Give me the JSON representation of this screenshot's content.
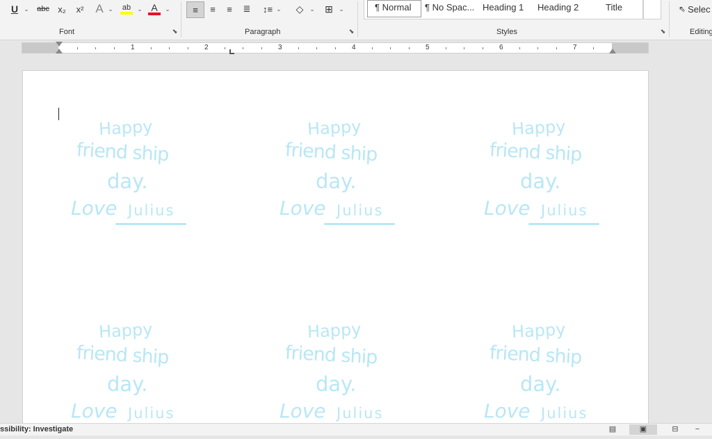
{
  "ribbon": {
    "groups": {
      "font": "Font",
      "paragraph": "Paragraph",
      "styles": "Styles",
      "editing": "Editing"
    },
    "font_tools": {
      "underline": "U",
      "strikethrough": "abc",
      "subscript": "x₂",
      "superscript": "x²",
      "text_effects": "A",
      "highlight": "ab",
      "font_color": "A"
    },
    "styles": [
      "¶ Normal",
      "¶ No Spac...",
      "Heading 1",
      "Heading 2",
      "Title"
    ],
    "editing": {
      "select": "Selec"
    },
    "colors": {
      "highlight": "#ffff00",
      "font_color": "#e81123"
    }
  },
  "ruler": {
    "numbers": [
      "1",
      "2",
      "3",
      "4",
      "5",
      "6",
      "7"
    ]
  },
  "labels": [
    {
      "line1": "Happy",
      "line2": "friend ship",
      "line3": "day.",
      "line4": "Love",
      "line5": "Julius"
    },
    {
      "line1": "Happy",
      "line2": "friend ship",
      "line3": "day.",
      "line4": "Love",
      "line5": "Julius"
    },
    {
      "line1": "Happy",
      "line2": "friend ship",
      "line3": "day.",
      "line4": "Love",
      "line5": "Julius"
    },
    {
      "line1": "Happy",
      "line2": "friend ship",
      "line3": "day.",
      "line4": "Love",
      "line5": "Julius"
    },
    {
      "line1": "Happy",
      "line2": "friend ship",
      "line3": "day.",
      "line4": "Love",
      "line5": "Julius"
    },
    {
      "line1": "Happy",
      "line2": "friend ship",
      "line3": "day.",
      "line4": "Love",
      "line5": "Julius"
    }
  ],
  "label_color": "#b8e7f6",
  "status": {
    "accessibility": "ssibility: Investigate"
  }
}
